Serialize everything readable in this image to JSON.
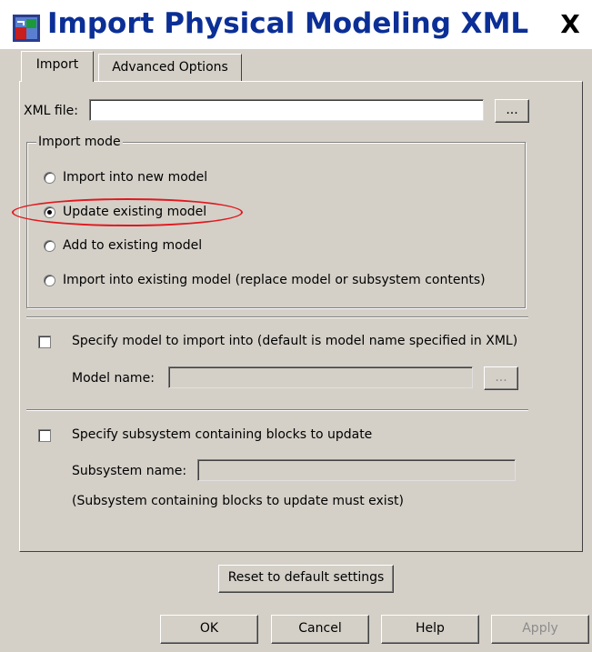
{
  "window": {
    "title": "Import Physical Modeling XML",
    "close_label": "X"
  },
  "tabs": [
    {
      "label": "Import",
      "active": true
    },
    {
      "label": "Advanced Options",
      "active": false
    }
  ],
  "xml_file": {
    "label": "XML file:",
    "value": "",
    "browse_label": "..."
  },
  "import_mode": {
    "title": "Import mode",
    "options": [
      {
        "label": "Import into new model",
        "selected": false
      },
      {
        "label": "Update existing model",
        "selected": true
      },
      {
        "label": "Add to existing model",
        "selected": false
      },
      {
        "label": "Import into existing model (replace model or subsystem contents)",
        "selected": false
      }
    ]
  },
  "specify_model": {
    "checkbox_label": "Specify model to import into (default is model name specified in XML)",
    "checked": false,
    "name_label": "Model name:",
    "name_value": "",
    "browse_label": "..."
  },
  "specify_subsystem": {
    "checkbox_label": "Specify subsystem containing blocks to update",
    "checked": false,
    "name_label": "Subsystem name:",
    "name_value": "",
    "note": "(Subsystem containing blocks to update must exist)"
  },
  "buttons": {
    "reset": "Reset to default settings",
    "ok": "OK",
    "cancel": "Cancel",
    "help": "Help",
    "apply": "Apply"
  },
  "annotation": {
    "highlight_color": "#e0181e"
  }
}
